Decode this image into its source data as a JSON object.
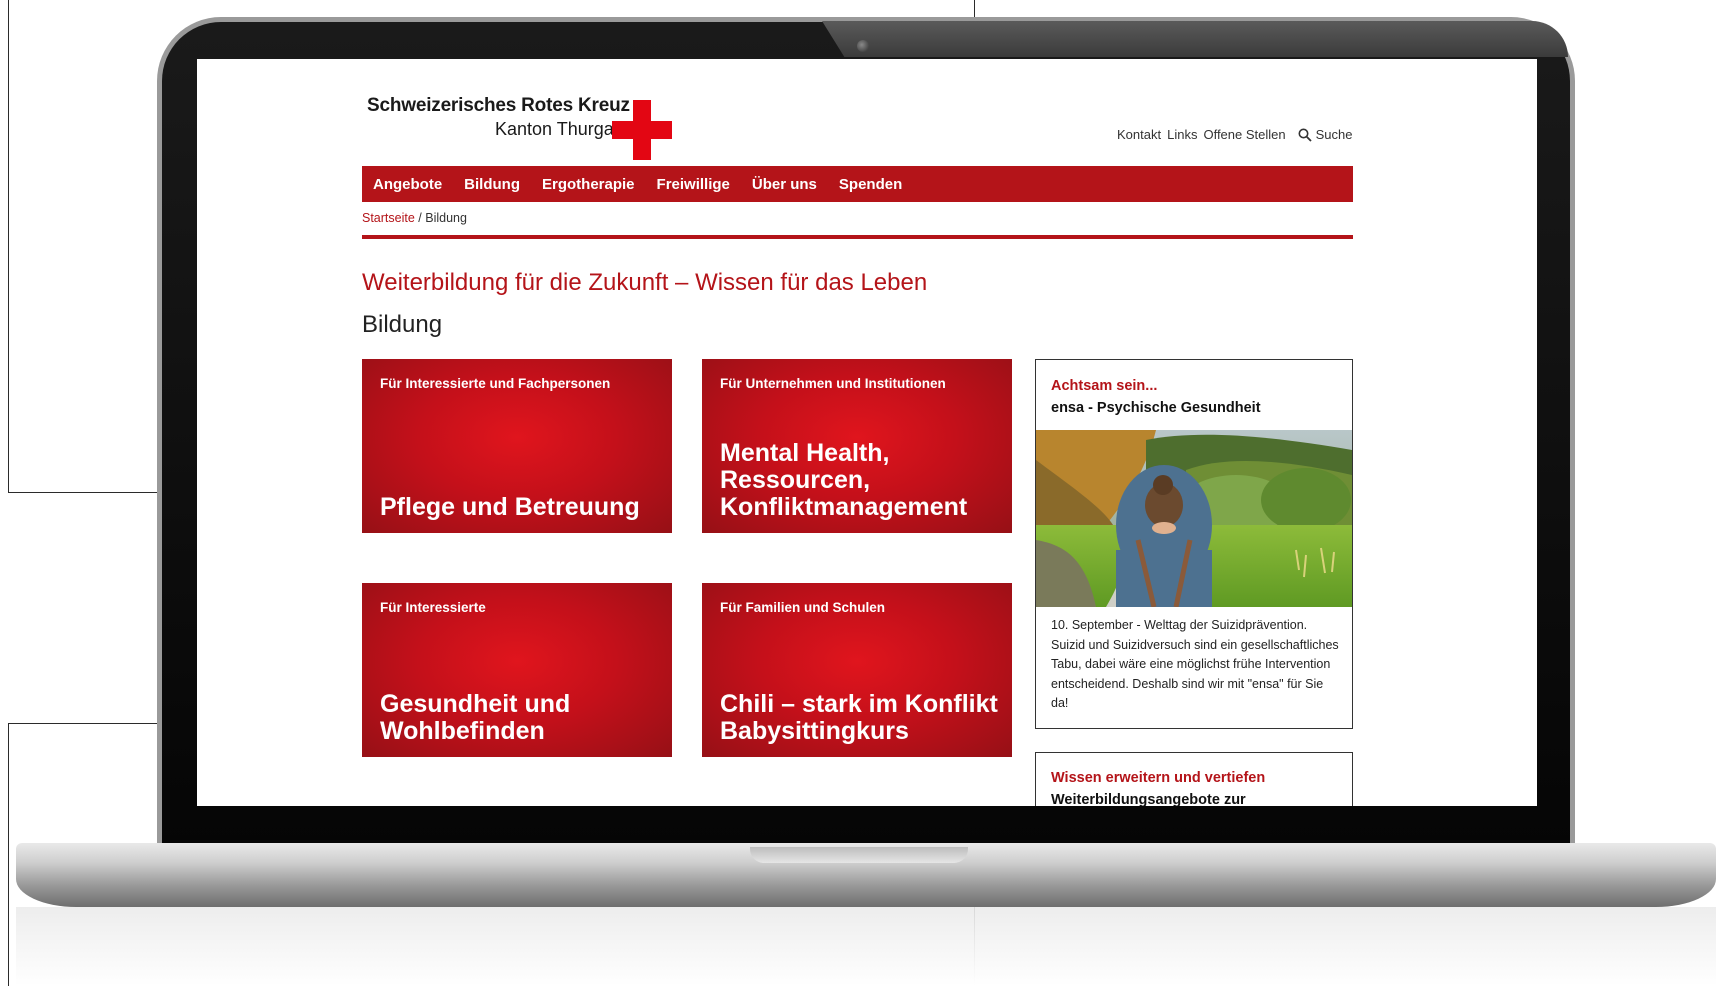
{
  "site": {
    "logo_line1": "Schweizerisches Rotes Kreuz",
    "logo_line2": "Kanton Thurgau"
  },
  "meta_nav": {
    "contact": "Kontakt",
    "links": "Links",
    "jobs": "Offene Stellen",
    "search": "Suche"
  },
  "main_nav": [
    "Angebote",
    "Bildung",
    "Ergotherapie",
    "Freiwillige",
    "Über uns",
    "Spenden"
  ],
  "breadcrumb": {
    "home": "Startseite",
    "separator": " / ",
    "current": "Bildung"
  },
  "page": {
    "headline": "Weiterbildung für die Zukunft – Wissen für das Leben",
    "title": "Bildung"
  },
  "tiles": [
    {
      "kicker": "Für Interessierte und Fachpersonen",
      "title": "Pflege und Betreuung"
    },
    {
      "kicker": "Für Unternehmen und Institutionen",
      "title": "Mental Health, Ressourcen, Konfliktmanagement"
    },
    {
      "kicker": "Für Interessierte",
      "title": "Gesundheit und Wohlbefinden"
    },
    {
      "kicker": "Für Familien und Schulen",
      "title": "Chili – stark im Konflikt Babysittingkurs"
    }
  ],
  "sidebar": {
    "card1": {
      "kicker": "Achtsam sein...",
      "title": "ensa - Psychische Gesundheit",
      "text": "10. September - Welttag der Suizidprävention. Suizid und Suizidversuch sind ein gesellschaftliches Tabu, dabei wäre eine möglichst frühe Intervention entscheidend. Deshalb sind wir mit \"ensa\" für Sie da!"
    },
    "card2": {
      "kicker": "Wissen erweitern und vertiefen",
      "title": "Weiterbildungsangebote zur"
    }
  },
  "colors": {
    "brand_red": "#b41419",
    "cross_red": "#e30613"
  }
}
